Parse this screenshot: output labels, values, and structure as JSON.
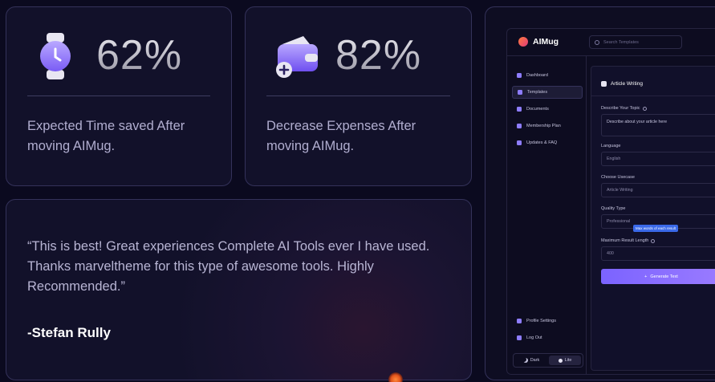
{
  "stats": [
    {
      "value": "62%",
      "description": "Expected Time saved After moving AIMug.",
      "icon": "watch-icon"
    },
    {
      "value": "82%",
      "description": "Decrease Expenses After moving AIMug.",
      "icon": "wallet-plus-icon"
    }
  ],
  "testimonial": {
    "quote": "“This is best! Great experiences Complete AI Tools ever I have used. Thanks marveltheme for this type of awesome tools. Highly Recommended.”",
    "author": "-Stefan Rully"
  },
  "app": {
    "brand": "AIMug",
    "search_placeholder": "Search Templates",
    "nav": [
      {
        "label": "Dashboard",
        "icon": "dashboard-icon"
      },
      {
        "label": "Templates",
        "icon": "templates-icon",
        "active": true
      },
      {
        "label": "Documents",
        "icon": "documents-icon"
      },
      {
        "label": "Membership Plan",
        "icon": "membership-icon"
      },
      {
        "label": "Updates & FAQ",
        "icon": "updates-icon"
      }
    ],
    "nav_bottom": [
      {
        "label": "Profile Settings",
        "icon": "user-icon"
      },
      {
        "label": "Log Out",
        "icon": "logout-icon"
      }
    ],
    "theme": {
      "dark": "Dark",
      "lite": "Lite",
      "selected": "Lite"
    },
    "form": {
      "title": "Article Writing",
      "topic_label": "Describe Your Topic",
      "topic_value": "Describe about your article here",
      "language_label": "Language",
      "language_value": "English",
      "usecase_label": "Choose Usecase",
      "usecase_value": "Article Writing",
      "quality_label": "Quality Type",
      "quality_value": "Professional",
      "tooltip": "Max words of each result",
      "length_label": "Maximum Result Length",
      "length_value": "400",
      "generate_label": "Generate Text"
    }
  },
  "colors": {
    "accent": "#8e7dff",
    "background": "#0b0a1f",
    "card": "#12112a",
    "tooltip": "#3a69e8"
  }
}
